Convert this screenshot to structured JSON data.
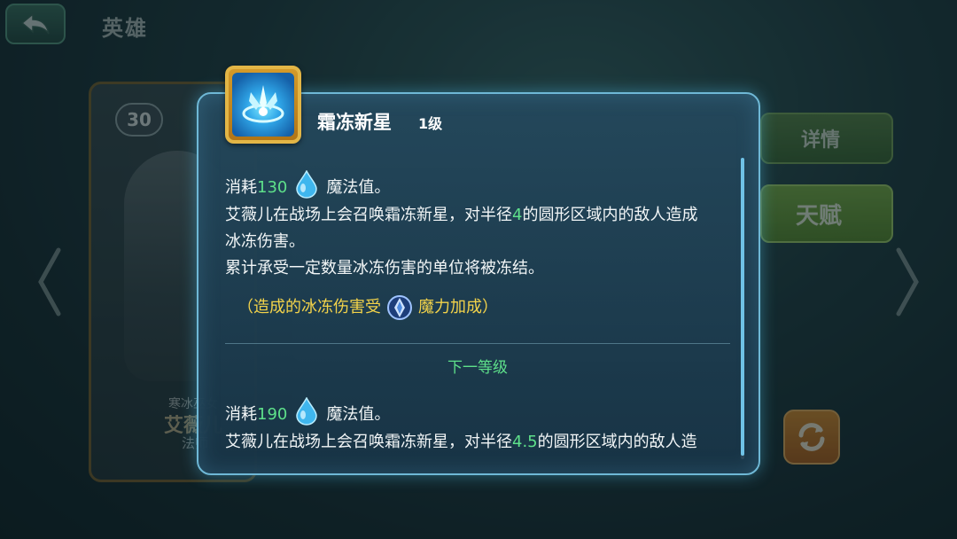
{
  "header": {
    "title": "英雄"
  },
  "hero": {
    "level": "30",
    "subtitle": "寒冰巫女",
    "name": "艾薇儿",
    "class": "法师"
  },
  "side_buttons": {
    "detail_label": "详情",
    "talent_label": "天赋"
  },
  "skill_popup": {
    "name": "霜冻新星",
    "level": "1级",
    "current": {
      "cost_prefix": "消耗",
      "cost_value": "130",
      "cost_suffix": "魔法值。",
      "desc_line1_a": "艾薇儿在战场上会召唤霜冻新星，对半径",
      "desc_line1_num": "4",
      "desc_line1_b": "的圆形区域内的敌人造成",
      "desc_line2": "冰冻伤害。",
      "desc_line3": "累计承受一定数量冰冻伤害的单位将被冻结。",
      "bonus_prefix": "（造成的冰冻伤害受",
      "bonus_suffix": "魔力加成）"
    },
    "next_level_label": "下一等级",
    "next": {
      "cost_prefix": "消耗",
      "cost_value": "190",
      "cost_suffix": "魔法值。",
      "desc_line1_a": "艾薇儿在战场上会召唤霜冻新星，对半径",
      "desc_line1_num": "4.5",
      "desc_line1_b": "的圆形区域内的敌人造"
    }
  },
  "icons": {
    "back": "back-arrow-icon",
    "mana": "mana-drop-icon",
    "magic_power": "magic-power-icon",
    "skill": "frost-nova-icon",
    "refresh": "refresh-icon"
  },
  "colors": {
    "highlight_number": "#5ee08a",
    "bonus_text": "#f3d34a",
    "popup_border": "#6fb8d6",
    "skill_frame": "#e3b646"
  }
}
